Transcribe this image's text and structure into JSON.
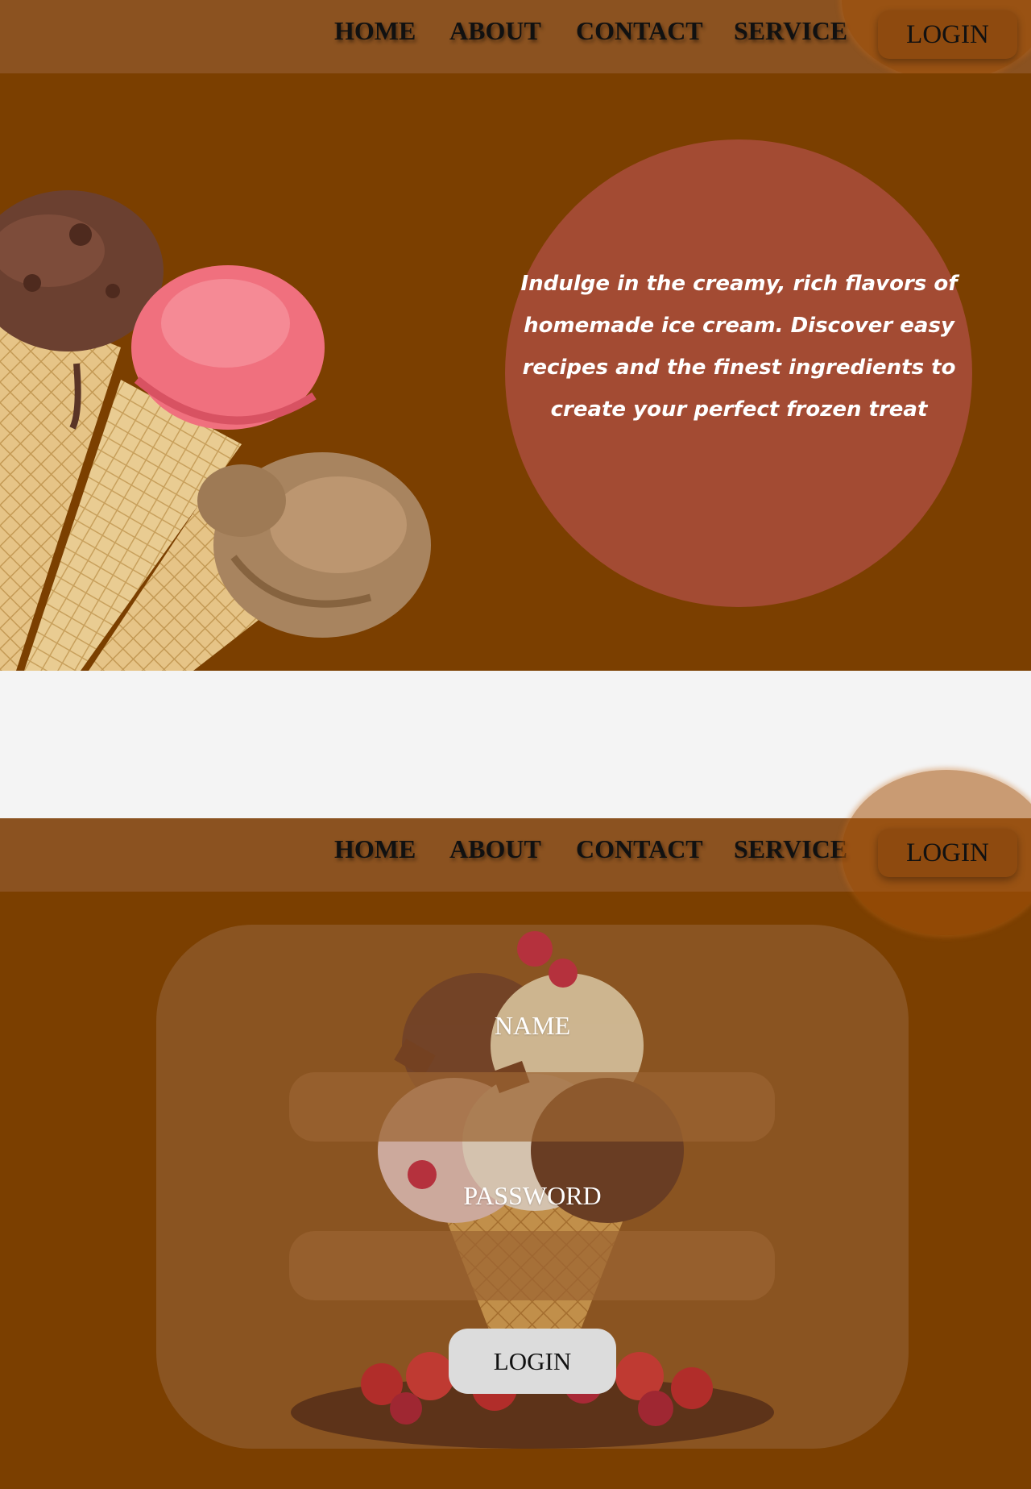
{
  "navbar": {
    "links": [
      "HOME",
      "ABOUT",
      "CONTACT",
      "SERVICE"
    ],
    "login_label": "LOGIN"
  },
  "hero": {
    "tagline": "Indulge in the creamy, rich flavors of homemade ice cream. Discover easy recipes and the finest ingredients to create your perfect frozen treat",
    "image_icon": "ice-cream-cones-illustration"
  },
  "navbar2": {
    "links": [
      "HOME",
      "ABOUT",
      "CONTACT",
      "SERVICE"
    ],
    "login_label": "LOGIN"
  },
  "login_form": {
    "name_label": "NAME",
    "name_value": "",
    "password_label": "PASSWORD",
    "password_value": "",
    "submit_label": "LOGIN",
    "background_icon": "ice-cream-sundae-illustration"
  },
  "colors": {
    "page_bg": "#7b3f00",
    "nav_bg": "#8b5220",
    "hero_circle": "#a34b33",
    "panel_bg": "#8a5421",
    "gap_bg": "#f4f4f4"
  }
}
